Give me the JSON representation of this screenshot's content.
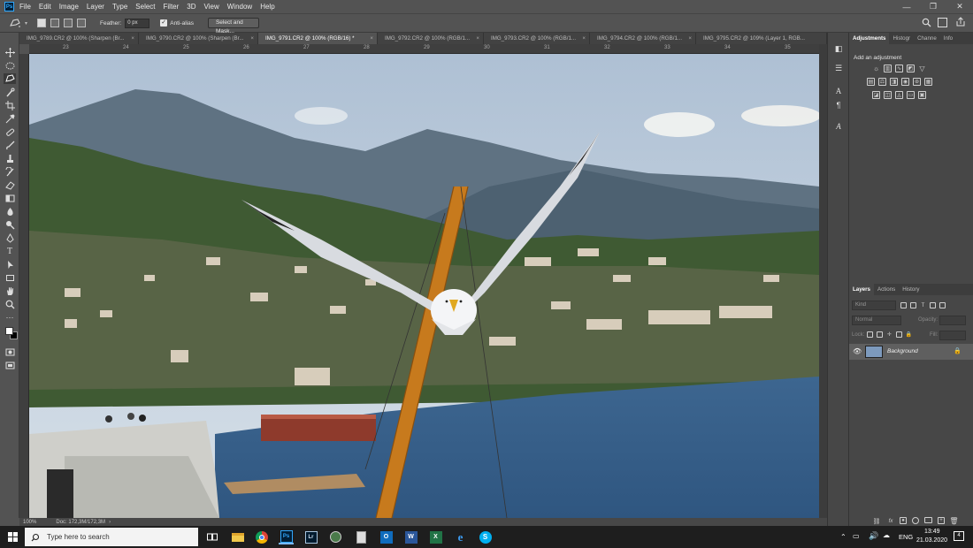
{
  "menubar": {
    "items": [
      "File",
      "Edit",
      "Image",
      "Layer",
      "Type",
      "Select",
      "Filter",
      "3D",
      "View",
      "Window",
      "Help"
    ]
  },
  "options": {
    "feather_label": "Feather:",
    "feather_value": "0 px",
    "anti_alias_label": "Anti-alias",
    "select_mask_label": "Select and Mask..."
  },
  "tabs": [
    {
      "label": "IMG_9789.CR2 @ 100% (Sharpen (Br..."
    },
    {
      "label": "IMG_9790.CR2 @ 100% (Sharpen (Br..."
    },
    {
      "label": "IMG_9791.CR2 @ 100% (RGB/16) *"
    },
    {
      "label": "IMG_9792.CR2 @ 100% (RGB/1..."
    },
    {
      "label": "IMG_9793.CR2 @ 100% (RGB/1..."
    },
    {
      "label": "IMG_9794.CR2 @ 100% (RGB/1..."
    },
    {
      "label": "IMG_9795.CR2 @ 109% (Layer 1, RGB..."
    }
  ],
  "ruler": {
    "top_ticks": [
      "23",
      "24",
      "25",
      "26",
      "27",
      "28",
      "29",
      "30",
      "31",
      "32",
      "33",
      "34",
      "35"
    ]
  },
  "status": {
    "zoom": "100%",
    "doc": "Doc: 172,3M/172,3M"
  },
  "adjustments_panel": {
    "tabs": [
      "Adjustments",
      "Histogr",
      "Channe",
      "Info"
    ],
    "heading": "Add an adjustment"
  },
  "layers_panel": {
    "tabs": [
      "Layers",
      "Actions",
      "History"
    ],
    "kind_label": "Kind",
    "blend_mode": "Normal",
    "opacity_label": "Opacity:",
    "lock_label": "Lock:",
    "fill_label": "Fill:",
    "layer_name": "Background"
  },
  "taskbar": {
    "search_placeholder": "Type here to search",
    "lang": "ENG",
    "time": "13:49",
    "date": "21.03.2020",
    "notification_count": "4"
  },
  "colors": {
    "ui_dark": "#535353",
    "panel": "#474747",
    "accent": "#31a8ff"
  }
}
